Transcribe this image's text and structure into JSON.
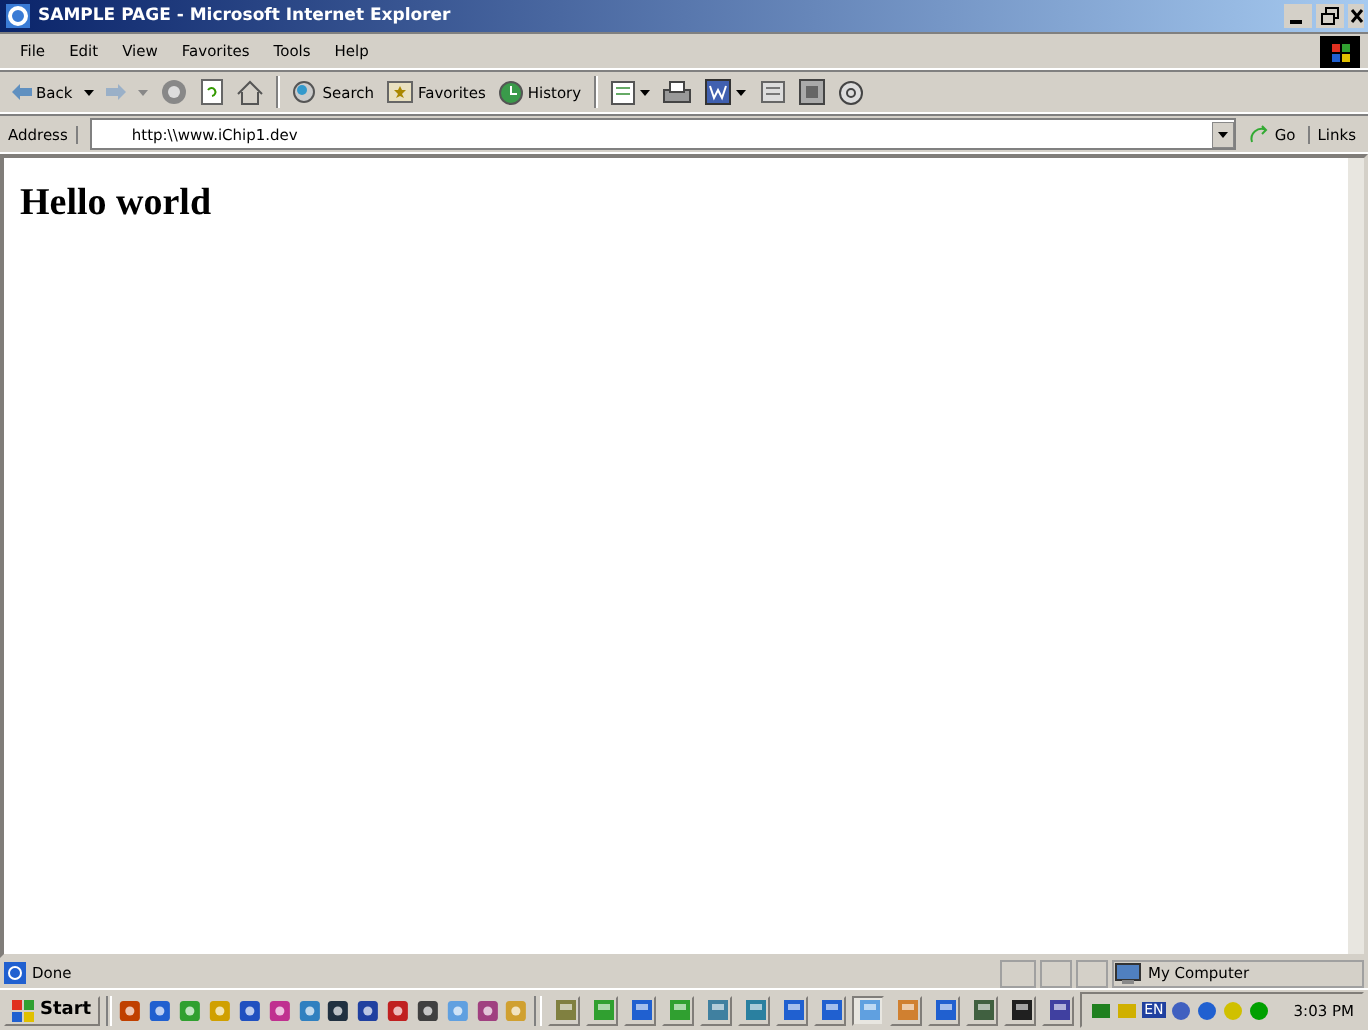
{
  "window": {
    "title": "SAMPLE PAGE - Microsoft Internet Explorer"
  },
  "menu": [
    "File",
    "Edit",
    "View",
    "Favorites",
    "Tools",
    "Help"
  ],
  "toolbar": {
    "back": "Back",
    "search": "Search",
    "favorites": "Favorites",
    "history": "History"
  },
  "address": {
    "label": "Address",
    "value": "http:\\\\www.iChip1.dev",
    "go": "Go",
    "links": "Links"
  },
  "page": {
    "heading": "Hello world"
  },
  "status_bar": {
    "text": "Done",
    "zone": "My Computer"
  },
  "taskbar": {
    "start": "Start",
    "tray_language": "EN",
    "clock": "3:03 PM"
  }
}
